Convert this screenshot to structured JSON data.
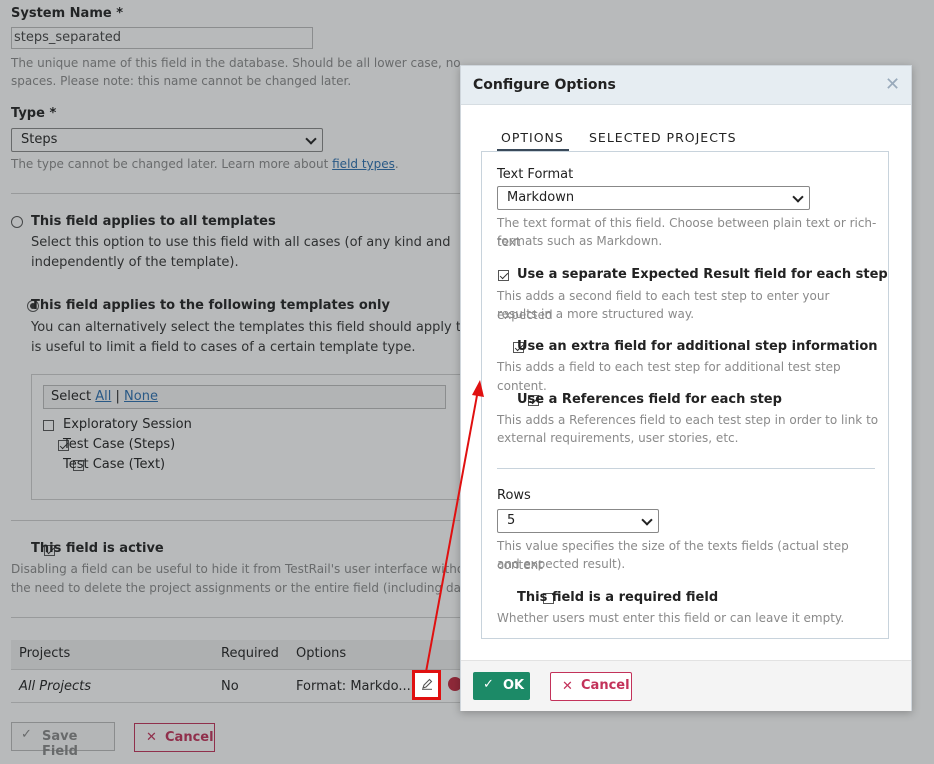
{
  "form": {
    "system_name_label": "System Name *",
    "system_name_value": "steps_separated",
    "system_name_help_1": "The unique name of this field in the database. Should be all lower case, no",
    "system_name_help_2": "spaces. Please note: this name cannot be changed later.",
    "type_label": "Type *",
    "type_value": "Steps",
    "type_help_prefix": "The type cannot be changed later. Learn more about ",
    "type_help_link": "field types",
    "type_help_suffix": ".",
    "all_templates_label": "This field applies to all templates",
    "all_templates_help_1": "Select this option to use this field with all cases (of any kind and",
    "all_templates_help_2": "independently of the template).",
    "some_templates_label": "This field applies to the following templates only",
    "some_templates_help_1": "You can alternatively select the templates this field should apply to. This",
    "some_templates_help_2": "is useful to limit a field to cases of a certain template type.",
    "select_prefix": "Select ",
    "select_all": "All",
    "select_sep": " | ",
    "select_none": "None",
    "templates": [
      {
        "label": "Exploratory Session",
        "checked": false
      },
      {
        "label": "Test Case (Steps)",
        "checked": true
      },
      {
        "label": "Test Case (Text)",
        "checked": false
      }
    ],
    "active_label": "This field is active",
    "active_help_1": "Disabling a field can be useful to hide it from TestRail's user interface without",
    "active_help_2": "the need to delete the project assignments or the entire field (including data)",
    "table_headers": [
      "Projects",
      "Required",
      "Options"
    ],
    "table_row": {
      "project": "All Projects",
      "required": "No",
      "options": "Format: Markdo..."
    },
    "save_label": "Save Field",
    "cancel_label": "Cancel"
  },
  "modal": {
    "title": "Configure Options",
    "tabs": [
      "OPTIONS",
      "SELECTED PROJECTS"
    ],
    "text_format_label": "Text Format",
    "text_format_value": "Markdown",
    "text_format_help_1": "The text format of this field. Choose between plain text or rich-text",
    "text_format_help_2": "formats such as Markdown.",
    "opt1_label": "Use a separate Expected Result field for each step",
    "opt1_help_1": "This adds a second field to each test step to enter your expected",
    "opt1_help_2": "results in a more structured way.",
    "opt2_label": "Use an extra field for additional step information",
    "opt2_help_1": "This adds a field to each test step for additional test step content.",
    "opt3_label": "Use a References field for each step",
    "opt3_help_1": "This adds a References field to each test step in order to link to",
    "opt3_help_2": "external requirements, user stories, etc.",
    "rows_label": "Rows",
    "rows_value": "5",
    "rows_help_1": "This value specifies the size of the texts fields (actual step content",
    "rows_help_2": "and expected result).",
    "required_label": "This field is a required field",
    "required_help": "Whether users must enter this field or can leave it empty.",
    "ok_label": "OK",
    "cancel_label": "Cancel"
  },
  "colors": {
    "ok_green": "#1c8a67",
    "cancel_red": "#c3325a",
    "annotation_red": "#e01010",
    "link_blue": "#2a6fb0"
  },
  "icons": [
    "check-icon",
    "close-icon",
    "pencil-icon",
    "delete-icon",
    "chevron-down-icon"
  ]
}
